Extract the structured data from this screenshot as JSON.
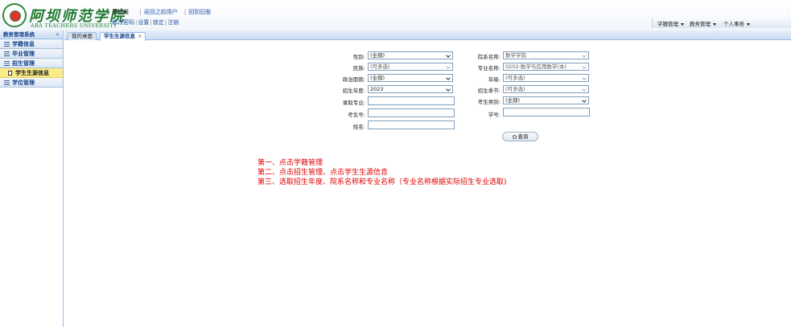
{
  "header": {
    "logo_cn": "阿坝师范学院",
    "logo_en": "ABA TEACHERS UNIVERSITY",
    "user_name": "黄旭缓",
    "links_row1": [
      "返回之前用户",
      "回到旧版"
    ],
    "links_row2": [
      "修改密码",
      "设置",
      "锁定",
      "注销"
    ],
    "top_menu": [
      "学籍管理",
      "教务管理",
      "个人事务"
    ]
  },
  "sidebar": {
    "title": "教务管理系统",
    "collapse_glyph": "«",
    "items": [
      {
        "label": "学籍信息"
      },
      {
        "label": "毕业管理"
      },
      {
        "label": "招生管理"
      },
      {
        "label": "学生生源信息"
      },
      {
        "label": "学位管理"
      }
    ]
  },
  "tabs": [
    {
      "label": "我的桌面"
    },
    {
      "label": "学生生源信息"
    }
  ],
  "tab_close": "×",
  "form": {
    "gender": {
      "label": "性别:",
      "value": "(全部)"
    },
    "ethnicity": {
      "label": "民族:",
      "value": "(可多选)"
    },
    "politics": {
      "label": "政治面貌:",
      "value": "(全部)"
    },
    "enroll_year": {
      "label": "招生年度:",
      "value": "2023"
    },
    "admit_major": {
      "label": "录取专业:",
      "value": ""
    },
    "exam_no": {
      "label": "考生号:",
      "value": ""
    },
    "name": {
      "label": "姓名:",
      "value": ""
    },
    "department": {
      "label": "院系名称:",
      "value": "数学学院"
    },
    "major": {
      "label": "专业名称:",
      "value": "0202-数学与应用数学(本)"
    },
    "grade": {
      "label": "年级:",
      "value": "(可多选)"
    },
    "enroll_season": {
      "label": "招生季节:",
      "value": "(可多选)"
    },
    "exam_category": {
      "label": "考生类别:",
      "value": "(全部)"
    },
    "student_no": {
      "label": "学号:",
      "value": ""
    },
    "query_label": "查询"
  },
  "instructions": [
    "第一、点击学籍管理",
    "第二、点击招生管理、点击学生生源信息",
    "第三、选取招生年度、院系名称和专业名称（专业名称根据实际招生专业选取)"
  ]
}
